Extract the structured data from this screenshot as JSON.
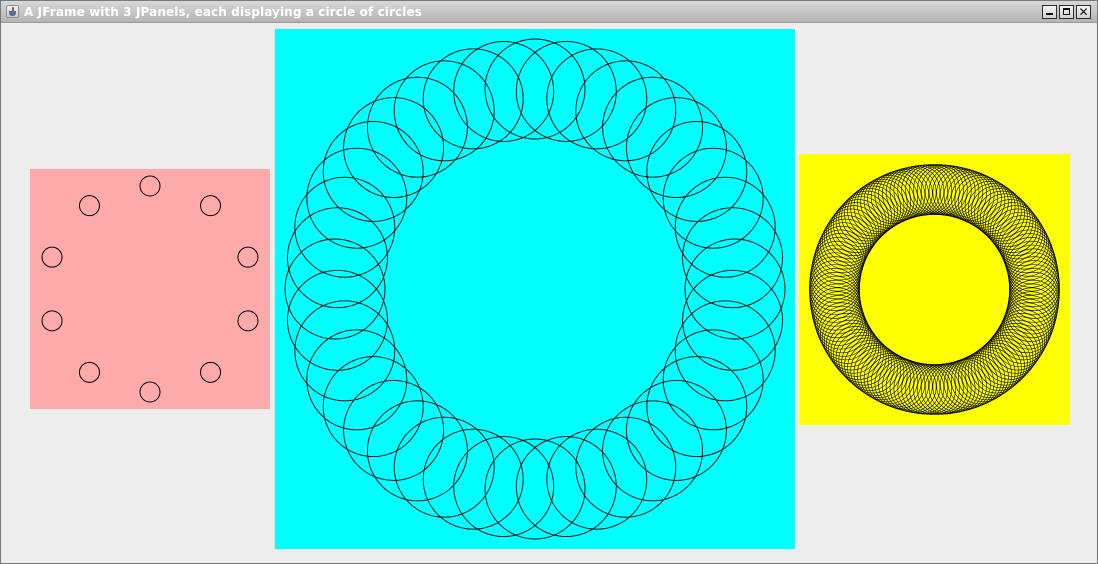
{
  "window": {
    "title": "A JFrame with 3 JPanels, each displaying a circle of circles",
    "app_icon": "java-cup-icon",
    "controls": [
      {
        "name": "minimize",
        "icon": "minimize-icon"
      },
      {
        "name": "maximize",
        "icon": "maximize-icon"
      },
      {
        "name": "close",
        "icon": "close-icon",
        "glyph": "✕"
      }
    ]
  },
  "panels": [
    {
      "name": "pink",
      "background": "#ffaaaa",
      "ring_circle_count": 10,
      "stroke": "#000000"
    },
    {
      "name": "cyan",
      "background": "#00ffff",
      "ring_circle_count": 40,
      "stroke": "#000000"
    },
    {
      "name": "yellow",
      "background": "#ffff00",
      "ring_circle_count": 160,
      "stroke": "#000000"
    }
  ]
}
